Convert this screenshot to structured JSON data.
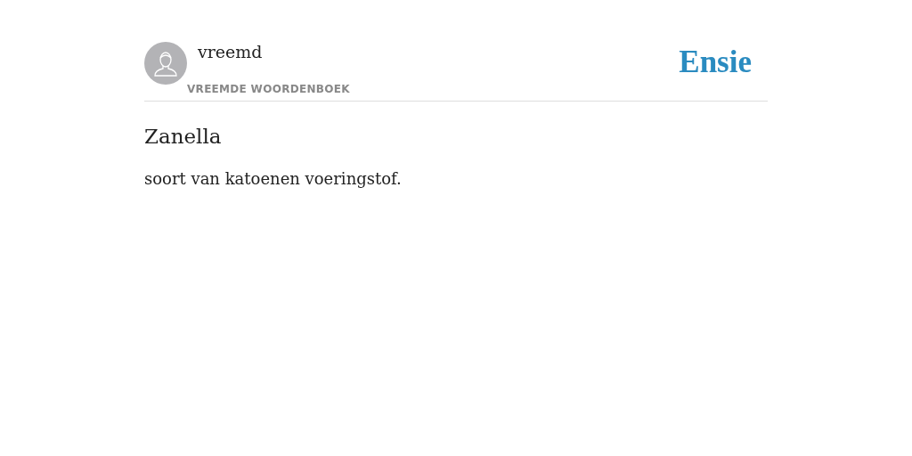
{
  "header": {
    "author": "vreemd",
    "source": "VREEMDE WOORDENBOEK",
    "logo": "Ensie"
  },
  "entry": {
    "term": "Zanella",
    "definition": "soort van katoenen voeringstof."
  }
}
